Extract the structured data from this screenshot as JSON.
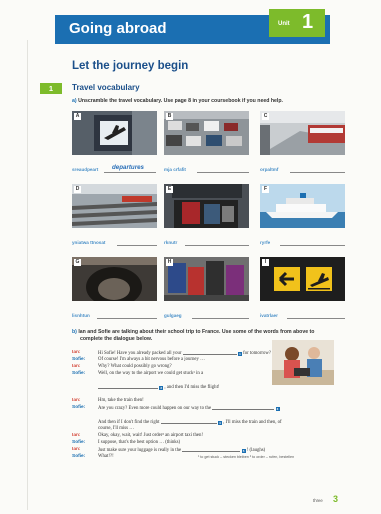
{
  "header": {
    "title": "Going abroad",
    "unit_label": "Unit",
    "unit_number": "1"
  },
  "heading": "Let the journey begin",
  "section": {
    "number": "1",
    "title": "Travel vocabulary"
  },
  "exercise_a": {
    "label": "a)",
    "instruction": "Unscramble the travel vocabulary. Use page 8 in your coursebook if you need help.",
    "items": [
      {
        "letter": "A",
        "scrambled": "sreaudpeart",
        "answer": "departures"
      },
      {
        "letter": "B",
        "scrambled": "mja crfafit",
        "answer": ""
      },
      {
        "letter": "C",
        "scrambled": "orpaltmf",
        "answer": ""
      },
      {
        "letter": "D",
        "scrambled": "yniatwa ttnosat",
        "answer": ""
      },
      {
        "letter": "E",
        "scrambled": "rknutr",
        "answer": ""
      },
      {
        "letter": "F",
        "scrambled": "ryrfe",
        "answer": ""
      },
      {
        "letter": "G",
        "scrambled": "lisnhtun",
        "answer": ""
      },
      {
        "letter": "H",
        "scrambled": "gulgaeg",
        "answer": ""
      },
      {
        "letter": "I",
        "scrambled": "ivatrlaer",
        "answer": ""
      }
    ]
  },
  "exercise_b": {
    "label": "b)",
    "instruction_1": "Ian and Sofie are talking about their school trip to France. Use some of the words from above to",
    "instruction_2": "complete the dialogue below.",
    "lines": [
      {
        "speaker": "Ian:",
        "parts": [
          "Hi Sofie! Have you already packed all your",
          "for tomorrow?"
        ],
        "gap": "1"
      },
      {
        "speaker": "Sofie:",
        "parts": [
          "Of course! I'm always a bit nervous before a journey …"
        ]
      },
      {
        "speaker": "Ian:",
        "parts": [
          "Why? What could possibly go wrong?"
        ]
      },
      {
        "speaker": "Sofie:",
        "parts": [
          "Well, on the way to the airport we could get stuck¹ in a"
        ]
      },
      {
        "speaker": "",
        "parts": [
          "",
          ", and then I'd miss the flight!"
        ],
        "gap": "2"
      },
      {
        "speaker": "Ian:",
        "parts": [
          "Hm, take the train then!"
        ]
      },
      {
        "speaker": "Sofie:",
        "parts": [
          "Are you crazy? Even more could happen on our way to the",
          ""
        ],
        "gap": "3"
      },
      {
        "speaker": "",
        "parts": [
          "And then if I don't find the right",
          ", I'll miss the train and then, of"
        ],
        "gap": "4"
      },
      {
        "speaker": "",
        "parts": [
          "course, I'll miss …"
        ]
      },
      {
        "speaker": "Ian:",
        "parts": [
          "Okay, okay, wait, wait! Just order² an airport taxi then!"
        ]
      },
      {
        "speaker": "Sofie:",
        "parts": [
          "I suppose, that's the best option … (thinks)"
        ]
      },
      {
        "speaker": "Ian:",
        "parts": [
          "Just make sure your luggage is really in the",
          "! (laughs)"
        ],
        "gap": "5"
      },
      {
        "speaker": "Sofie:",
        "parts": [
          "What!?!"
        ]
      }
    ],
    "footnotes": "¹ to get stuck – stecken bleiben    ² to order – rufen, bestellen"
  },
  "footer": {
    "page_word": "three",
    "page_number": "3"
  },
  "colors": {
    "primary_blue": "#1b6fb2",
    "green": "#7dbb2b",
    "speaker_red": "#d4483b"
  }
}
